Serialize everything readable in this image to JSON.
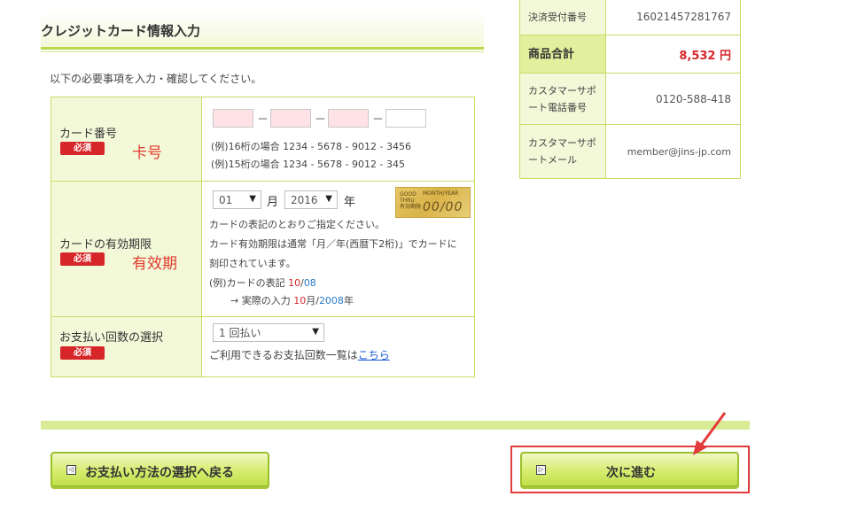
{
  "section_title": "クレジットカード情報入力",
  "intro_text": "以下の必要事項を入力・確認してください。",
  "required_badge": "必須",
  "card_number": {
    "label": "カード番号",
    "annotation": "卡号",
    "dash": "－",
    "example_16": "(例)16桁の場合 1234 - 5678 - 9012 - 3456",
    "example_15": "(例)15桁の場合 1234 - 5678 - 9012 - 345"
  },
  "expiry": {
    "label": "カードの有効期限",
    "annotation": "有效期",
    "month_value": "01",
    "month_unit": "月",
    "year_value": "2016",
    "year_unit": "年",
    "card_image_text_a": "GOOD THRU 有効期限",
    "card_image_text_b": "MONTH/YEAR",
    "card_image_text_c": "00/00",
    "note1": "カードの表記のとおりご指定ください。",
    "note2": "カード有効期限は通常「月／年(西暦下2桁)」でカードに",
    "note3": "刻印されています。",
    "ex_label": "(例)カードの表記 ",
    "ex_month": "10",
    "ex_slash": "/",
    "ex_year": "08",
    "ex_input_label": "→ 実際の入力 ",
    "ex_input_month": "10",
    "ex_input_month_unit": "月/",
    "ex_input_year": "2008",
    "ex_input_year_unit": "年"
  },
  "payment_count": {
    "label": "お支払い回数の選択",
    "selected": "1 回払い",
    "note_prefix": "ご利用できるお支払回数一覧は",
    "note_link": "こちら"
  },
  "summary": {
    "rows": [
      {
        "label": "決済受付番号",
        "value": "16021457281767"
      },
      {
        "label": "商品合計",
        "value": "8,532 円"
      },
      {
        "label": "カスタマーサポート電話番号",
        "value": "0120-588-418"
      },
      {
        "label": "カスタマーサポートメール",
        "value": "member@jins-jp.com"
      }
    ]
  },
  "buttons": {
    "back_label": "お支払い方法の選択へ戻る",
    "next_label": "次に進む"
  },
  "colors": {
    "accent_green": "#b7d94a",
    "required_red": "#d7262a",
    "highlight_red": "#e23b3b"
  }
}
